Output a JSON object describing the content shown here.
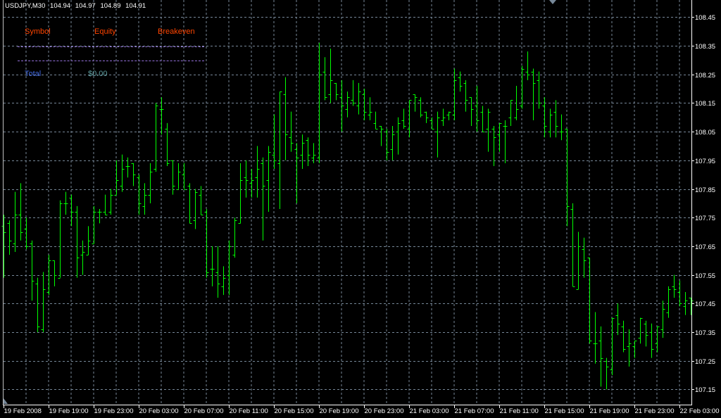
{
  "header": {
    "symbol": "USDJPY,M30",
    "open": "104.94",
    "high": "104.97",
    "low": "104.89",
    "close": "104.91"
  },
  "overlay": {
    "col_symbol": "Symbol",
    "col_equity": "Equity",
    "col_breakeven": "Breakeven",
    "total_label": "Total",
    "total_value": "$0.00"
  },
  "colors": {
    "background": "#000000",
    "grid": "#778899",
    "bars": "#00ff00",
    "axis": "#ffffff",
    "header_cols": "#ff4500",
    "separator": "#9370db",
    "total_label": "#4169e1",
    "total_value": "#5f9ea0"
  },
  "chart_data": {
    "type": "ohlc",
    "symbol": "USDJPY",
    "timeframe": "M30",
    "ylim": [
      107.1,
      108.48
    ],
    "y_ticks": [
      "108.45",
      "108.35",
      "108.25",
      "108.15",
      "108.05",
      "107.95",
      "107.85",
      "107.75",
      "107.65",
      "107.55",
      "107.45",
      "107.35",
      "107.25",
      "107.15"
    ],
    "x_ticks": [
      "19 Feb 2008",
      "19 Feb 19:00",
      "19 Feb 23:00",
      "20 Feb 03:00",
      "20 Feb 07:00",
      "20 Feb 11:00",
      "20 Feb 15:00",
      "20 Feb 19:00",
      "20 Feb 23:00",
      "21 Feb 03:00",
      "21 Feb 07:00",
      "21 Feb 11:00",
      "21 Feb 15:00",
      "21 Feb 19:00",
      "21 Feb 23:00",
      "22 Feb 03:00"
    ],
    "bars_per_x_tick": 8,
    "grid": true,
    "ohlc": [
      [
        107.72,
        107.76,
        107.54,
        107.7
      ],
      [
        107.73,
        107.74,
        107.62,
        107.67
      ],
      [
        107.66,
        107.84,
        107.63,
        107.76
      ],
      [
        107.76,
        107.87,
        107.67,
        107.7
      ],
      [
        107.71,
        107.75,
        107.64,
        107.65
      ],
      [
        107.66,
        107.67,
        107.46,
        107.53
      ],
      [
        107.52,
        107.54,
        107.35,
        107.37
      ],
      [
        107.36,
        107.56,
        107.35,
        107.5
      ],
      [
        107.49,
        107.62,
        107.48,
        107.6
      ],
      [
        107.6,
        107.6,
        107.51,
        107.55
      ],
      [
        107.54,
        107.81,
        107.54,
        107.8
      ],
      [
        107.8,
        107.84,
        107.76,
        107.8
      ],
      [
        107.82,
        107.83,
        107.72,
        107.77
      ],
      [
        107.77,
        107.79,
        107.54,
        107.61
      ],
      [
        107.62,
        107.67,
        107.55,
        107.63
      ],
      [
        107.62,
        107.72,
        107.62,
        107.67
      ],
      [
        107.66,
        107.79,
        107.66,
        107.77
      ],
      [
        107.77,
        107.78,
        107.73,
        107.77
      ],
      [
        107.77,
        107.83,
        107.76,
        107.76
      ],
      [
        107.77,
        107.85,
        107.76,
        107.83
      ],
      [
        107.83,
        107.95,
        107.83,
        107.88
      ],
      [
        107.86,
        107.97,
        107.84,
        107.92
      ],
      [
        107.93,
        107.96,
        107.89,
        107.93
      ],
      [
        107.94,
        107.94,
        107.86,
        107.9
      ],
      [
        107.89,
        107.9,
        107.76,
        107.8
      ],
      [
        107.79,
        107.87,
        107.76,
        107.83
      ],
      [
        107.83,
        107.94,
        107.8,
        107.91
      ],
      [
        107.92,
        108.15,
        107.91,
        108.14
      ],
      [
        108.13,
        108.17,
        108.04,
        108.13
      ],
      [
        108.06,
        108.08,
        107.93,
        107.94
      ],
      [
        107.95,
        107.95,
        107.83,
        107.86
      ],
      [
        107.85,
        107.94,
        107.85,
        107.91
      ],
      [
        107.9,
        107.94,
        107.85,
        107.85
      ],
      [
        107.86,
        107.87,
        107.73,
        107.73
      ],
      [
        107.74,
        107.85,
        107.71,
        107.84
      ],
      [
        107.83,
        107.86,
        107.76,
        107.76
      ],
      [
        107.77,
        107.78,
        107.54,
        107.56
      ],
      [
        107.57,
        107.65,
        107.51,
        107.57
      ],
      [
        107.56,
        107.65,
        107.47,
        107.52
      ],
      [
        107.51,
        107.58,
        107.48,
        107.54
      ],
      [
        107.55,
        107.67,
        107.48,
        107.65
      ],
      [
        107.62,
        107.75,
        107.61,
        107.74
      ],
      [
        107.73,
        107.94,
        107.73,
        107.88
      ],
      [
        107.89,
        107.95,
        107.82,
        107.88
      ],
      [
        107.87,
        107.92,
        107.82,
        107.88
      ],
      [
        107.89,
        108.0,
        107.82,
        107.92
      ],
      [
        107.94,
        107.96,
        107.67,
        107.86
      ],
      [
        107.88,
        108.0,
        107.77,
        107.98
      ],
      [
        107.97,
        108.11,
        107.92,
        107.95
      ],
      [
        107.94,
        108.19,
        107.78,
        108.19
      ],
      [
        108.18,
        108.24,
        107.95,
        108.04
      ],
      [
        108.03,
        108.12,
        107.98,
        108.01
      ],
      [
        107.99,
        108.01,
        107.8,
        107.96
      ],
      [
        107.97,
        108.04,
        107.92,
        108.01
      ],
      [
        108.02,
        108.03,
        107.93,
        107.97
      ],
      [
        107.96,
        108.01,
        107.94,
        107.97
      ],
      [
        107.96,
        108.36,
        107.94,
        108.25
      ],
      [
        108.26,
        108.31,
        108.16,
        108.17
      ],
      [
        108.18,
        108.34,
        108.15,
        108.23
      ],
      [
        108.22,
        108.22,
        108.16,
        108.18
      ],
      [
        108.17,
        108.23,
        108.05,
        108.14
      ],
      [
        108.13,
        108.19,
        108.1,
        108.17
      ],
      [
        108.16,
        108.23,
        108.14,
        108.15
      ],
      [
        108.14,
        108.22,
        108.11,
        108.19
      ],
      [
        108.18,
        108.2,
        108.09,
        108.12
      ],
      [
        108.11,
        108.17,
        108.09,
        108.12
      ],
      [
        108.08,
        108.12,
        108.06,
        108.06
      ],
      [
        108.07,
        108.07,
        108.0,
        108.06
      ],
      [
        108.05,
        108.06,
        107.95,
        107.98
      ],
      [
        107.99,
        108.07,
        107.95,
        108.04
      ],
      [
        108.05,
        108.1,
        107.97,
        108.08
      ],
      [
        108.09,
        108.13,
        108.06,
        108.07
      ],
      [
        108.06,
        108.16,
        108.03,
        108.16
      ],
      [
        108.18,
        108.18,
        108.12,
        108.17
      ],
      [
        108.16,
        108.17,
        108.1,
        108.11
      ],
      [
        108.12,
        108.12,
        108.08,
        108.1
      ],
      [
        108.09,
        108.1,
        108.06,
        108.06
      ],
      [
        108.05,
        108.12,
        107.96,
        108.1
      ],
      [
        108.09,
        108.13,
        108.07,
        108.1
      ],
      [
        108.11,
        108.12,
        108.09,
        108.12
      ],
      [
        108.11,
        108.27,
        108.09,
        108.23
      ],
      [
        108.24,
        108.26,
        108.19,
        108.21
      ],
      [
        108.22,
        108.23,
        108.12,
        108.16
      ],
      [
        108.17,
        108.17,
        108.07,
        108.13
      ],
      [
        108.14,
        108.21,
        108.05,
        108.09
      ],
      [
        108.12,
        108.14,
        108.05,
        108.05
      ],
      [
        108.06,
        108.13,
        107.98,
        108.12
      ],
      [
        108.06,
        108.07,
        107.93,
        108.03
      ],
      [
        108.04,
        108.08,
        107.98,
        108.08
      ],
      [
        108.07,
        108.09,
        107.94,
        108.07
      ],
      [
        108.1,
        108.16,
        108.07,
        108.16
      ],
      [
        108.1,
        108.21,
        108.09,
        108.13
      ],
      [
        108.14,
        108.28,
        108.13,
        108.27
      ],
      [
        108.26,
        108.33,
        108.23,
        108.25
      ],
      [
        108.26,
        108.27,
        108.09,
        108.22
      ],
      [
        108.23,
        108.26,
        108.13,
        108.15
      ],
      [
        108.14,
        108.17,
        108.03,
        108.07
      ],
      [
        108.05,
        108.13,
        108.03,
        108.11
      ],
      [
        108.12,
        108.16,
        108.03,
        108.07
      ],
      [
        108.05,
        108.11,
        108.02,
        108.05
      ],
      [
        108.06,
        108.06,
        107.72,
        107.79
      ],
      [
        107.78,
        107.8,
        107.51,
        107.51
      ],
      [
        107.5,
        107.7,
        107.5,
        107.65
      ],
      [
        107.64,
        107.68,
        107.54,
        107.6
      ],
      [
        107.61,
        107.61,
        107.31,
        107.32
      ],
      [
        107.31,
        107.42,
        107.24,
        107.31
      ],
      [
        107.32,
        107.37,
        107.16,
        107.26
      ],
      [
        107.25,
        107.26,
        107.15,
        107.23
      ],
      [
        107.22,
        107.4,
        107.2,
        107.4
      ],
      [
        107.41,
        107.45,
        107.34,
        107.38
      ],
      [
        107.37,
        107.39,
        107.28,
        107.29
      ],
      [
        107.3,
        107.36,
        107.23,
        107.31
      ],
      [
        107.3,
        107.32,
        107.26,
        107.32
      ],
      [
        107.33,
        107.4,
        107.31,
        107.4
      ],
      [
        107.38,
        107.39,
        107.3,
        107.34
      ],
      [
        107.35,
        107.38,
        107.26,
        107.29
      ],
      [
        107.31,
        107.37,
        107.28,
        107.37
      ],
      [
        107.36,
        107.46,
        107.33,
        107.43
      ],
      [
        107.42,
        107.51,
        107.4,
        107.5
      ],
      [
        107.51,
        107.55,
        107.47,
        107.5
      ],
      [
        107.49,
        107.53,
        107.44,
        107.45
      ],
      [
        107.44,
        107.49,
        107.41,
        107.46
      ],
      [
        107.47,
        107.47,
        107.41,
        107.46
      ]
    ]
  }
}
